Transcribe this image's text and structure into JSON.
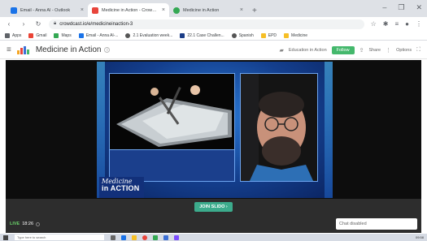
{
  "tabs": [
    {
      "label": "Email - Anna Al - Outlook",
      "favicon_color": "#1a73e8",
      "active": false
    },
    {
      "label": "Medicine in Action - Crowdcast",
      "favicon_color": "#e8453c",
      "active": true
    },
    {
      "label": "Medicine in Action",
      "favicon_color": "#34a853",
      "active": false
    }
  ],
  "tab_close_glyph": "×",
  "new_tab_glyph": "+",
  "window_controls": [
    "–",
    "❐",
    "✕"
  ],
  "address": {
    "url": "crowdcast.io/e/medicineinaction-3"
  },
  "bookmarks": [
    {
      "label": "Apps",
      "color": "#5f6368"
    },
    {
      "label": "Gmail",
      "color": "#ea4335"
    },
    {
      "label": "Maps",
      "color": "#34a853"
    },
    {
      "label": "Email - Anna Al-...",
      "color": "#1a73e8"
    },
    {
      "label": "2.1 Evaluation week...",
      "color": "#555"
    },
    {
      "label": "22.1 Case Challen...",
      "color": "#1a3c86"
    },
    {
      "label": "Spanish",
      "color": "#555"
    },
    {
      "label": "EPD",
      "color": "#f6bf26"
    },
    {
      "label": "Medicine",
      "color": "#f6bf26"
    }
  ],
  "site": {
    "channel_title": "Medicine in Action",
    "info_glyph": "i",
    "org_label": "Education in Action",
    "follow_label": "Follow",
    "share_label": "Share",
    "options_label": "Options"
  },
  "player": {
    "watermark_script": "Medicine",
    "watermark_block": "in ACTION",
    "join_label": "JOIN SLIDO ›"
  },
  "status": {
    "live_label": "LIVE",
    "live_time": "18:26",
    "chat_placeholder": "Chat disabled"
  },
  "taskbar": {
    "search_placeholder": "Type here to search",
    "clock": "09:58"
  },
  "colors": {
    "accent_green": "#44b86c",
    "slido_green": "#3cab8c",
    "frame_blue": "#143f8e"
  }
}
